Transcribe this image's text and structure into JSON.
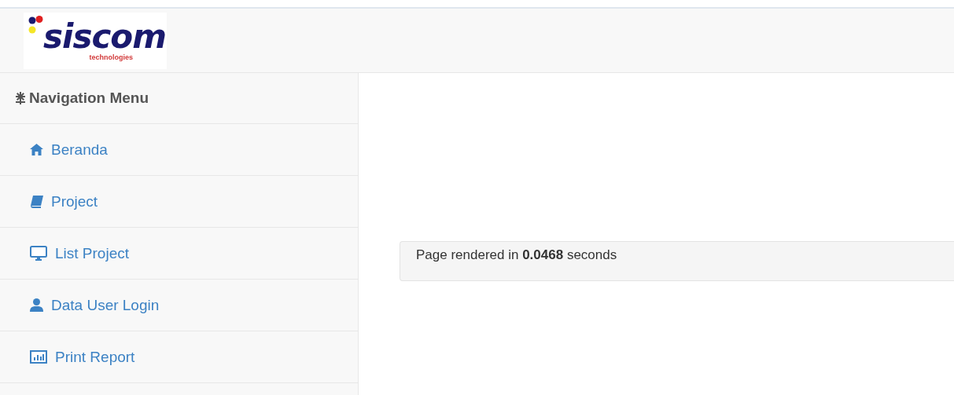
{
  "header": {
    "logo": {
      "name": "siscom",
      "tagline": "technologies"
    }
  },
  "sidebar": {
    "title": "Navigation Menu",
    "items": [
      {
        "label": "Beranda",
        "kind": "home"
      },
      {
        "label": "Project",
        "kind": "book"
      },
      {
        "label": "List Project",
        "kind": "monitor"
      },
      {
        "label": "Data User Login",
        "kind": "user"
      },
      {
        "label": "Print Report",
        "kind": "chart"
      }
    ]
  },
  "main": {
    "footer_note": "Page rendered in **0.0468** seconds"
  }
}
